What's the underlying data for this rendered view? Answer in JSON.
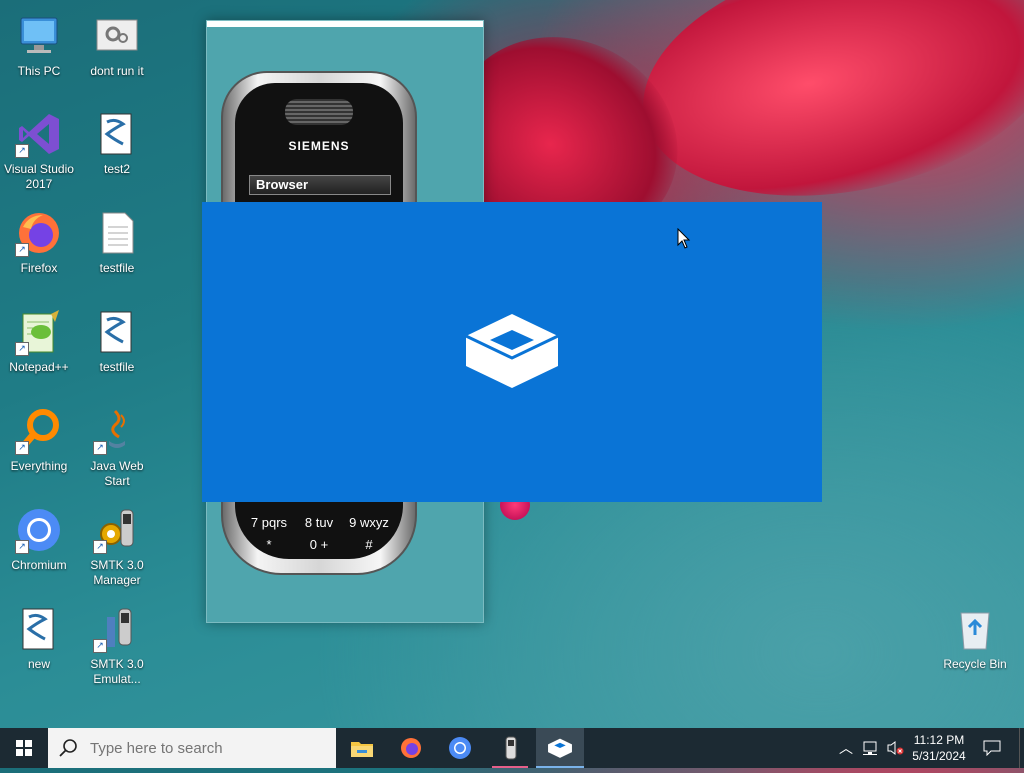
{
  "desktop": {
    "icons": [
      {
        "label": "This PC"
      },
      {
        "label": "dont run it"
      },
      {
        "label": "Visual Studio 2017"
      },
      {
        "label": "test2"
      },
      {
        "label": "Firefox"
      },
      {
        "label": "testfile"
      },
      {
        "label": "Notepad++"
      },
      {
        "label": "testfile"
      },
      {
        "label": "Everything"
      },
      {
        "label": "Java Web Start"
      },
      {
        "label": "Chromium"
      },
      {
        "label": "SMTK 3.0 Manager"
      },
      {
        "label": "new"
      },
      {
        "label": "SMTK 3.0 Emulat..."
      },
      {
        "label": "Recycle Bin"
      }
    ]
  },
  "emulator": {
    "brand": "SIEMENS",
    "screen_title": "Browser",
    "keys": [
      "8 tuv",
      "0 +",
      "7 pqrs",
      "9 wxyz",
      "*",
      "#"
    ]
  },
  "taskbar": {
    "search_placeholder": "Type here to search",
    "apps": [
      "file-explorer-icon",
      "firefox-icon",
      "chromium-icon",
      "smtk-icon",
      "sandbox-icon"
    ],
    "clock_time": "11:12 PM",
    "clock_date": "5/31/2024"
  },
  "colors": {
    "splash_blue": "#0a74d6",
    "taskbar": "#1c2a33",
    "desktop_teal": "#1f7c86"
  }
}
